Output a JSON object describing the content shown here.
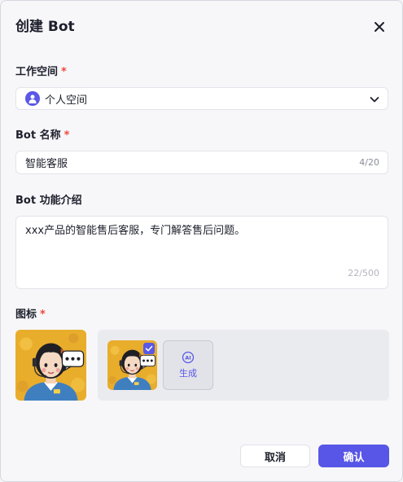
{
  "dialog": {
    "title": "创建 Bot"
  },
  "workspace": {
    "label": "工作空间",
    "required_mark": "*",
    "value": "个人空间"
  },
  "bot_name": {
    "label": "Bot 名称",
    "required_mark": "*",
    "value": "智能客服",
    "counter": "4/20"
  },
  "bot_desc": {
    "label": "Bot 功能介绍",
    "value": "xxx产品的智能售后客服，专门解答售后问题。",
    "counter": "22/500"
  },
  "icon": {
    "label": "图标",
    "required_mark": "*",
    "generate_label": "生成",
    "ai_badge": "AI"
  },
  "footer": {
    "cancel_label": "取消",
    "confirm_label": "确认"
  },
  "colors": {
    "accent": "#5856e6",
    "required": "#f0473d",
    "icon_bg": "#e9ad2c"
  }
}
